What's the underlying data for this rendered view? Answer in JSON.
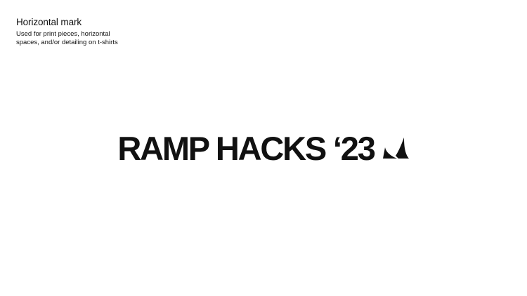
{
  "caption": {
    "title": "Horizontal mark",
    "description": "Used for print pieces, horizontal spaces, and/or detailing on t-shirts"
  },
  "mark": {
    "wordmark": "RAMP HACKS ‘23",
    "icon": "ramp-leaf-icon",
    "color": "#111111"
  },
  "colors": {
    "background": "#ffffff",
    "ink": "#111111"
  }
}
